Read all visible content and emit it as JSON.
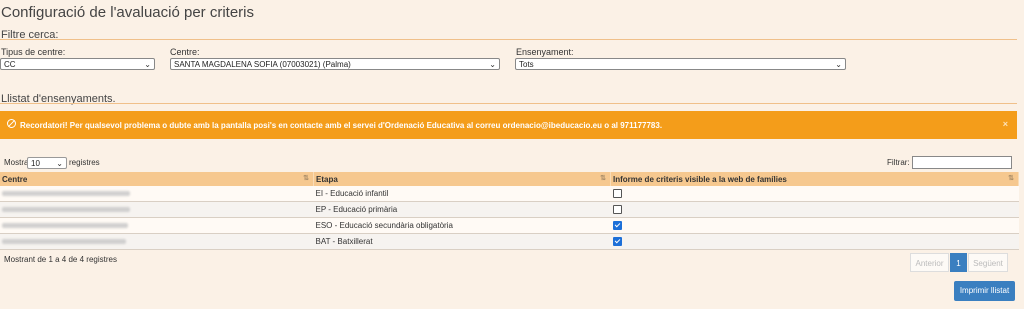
{
  "page_title": "Configuració de l'avaluació per criteris",
  "filter_section": {
    "title": "Filtre cerca:",
    "centre_type": {
      "label": "Tipus de centre:",
      "value": "CC"
    },
    "centre": {
      "label": "Centre:",
      "value": "SANTA MAGDALENA SOFIA (07003021) (Palma)"
    },
    "teaching": {
      "label": "Ensenyament:",
      "value": "Tots"
    }
  },
  "list_section": {
    "title": "Llistat d'ensenyaments."
  },
  "alert": {
    "text": "Recordatori! Per qualsevol problema o dubte amb la pantalla posi's en contacte amb el servei d'Ordenació Educativa al correu ordenacio@ibeducacio.eu o al 971177783.",
    "close": "×"
  },
  "table_controls": {
    "show_prefix": "Mostra",
    "page_length": "10",
    "show_suffix": "registres",
    "filter_label": "Filtrar:"
  },
  "table": {
    "headers": [
      "Centre",
      "Etapa",
      "Informe de criteris visible a la web de famílies"
    ],
    "rows": [
      {
        "etapa": "EI - Educació infantil",
        "visible": false
      },
      {
        "etapa": "EP - Educació primària",
        "visible": false
      },
      {
        "etapa": "ESO - Educació secundària obligatòria",
        "visible": true
      },
      {
        "etapa": "BAT - Batxillerat",
        "visible": true
      }
    ]
  },
  "info_text": "Mostrant de 1 a 4 de 4 registres",
  "pagination": {
    "previous": "Anterior",
    "current": "1",
    "next": "Següent"
  },
  "print_button": "Imprimir llistat",
  "colors": {
    "accent": "#f49d1a",
    "header": "#f6c88f",
    "primary": "#3a7fc0",
    "background": "#fbf1e6"
  }
}
